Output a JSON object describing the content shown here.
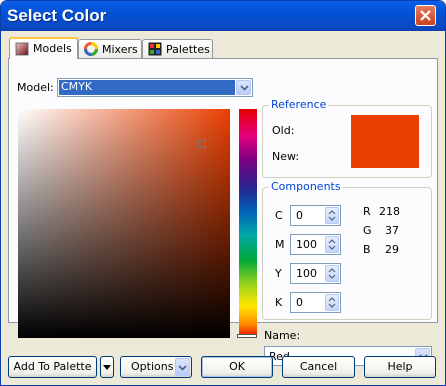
{
  "window": {
    "title": "Select Color"
  },
  "tabs": [
    {
      "label": "Models",
      "active": true,
      "icon": "models-icon"
    },
    {
      "label": "Mixers",
      "active": false,
      "icon": "color-wheel-icon"
    },
    {
      "label": "Palettes",
      "active": false,
      "icon": "palette-grid-icon"
    }
  ],
  "model": {
    "label": "Model:",
    "selected": "CMYK"
  },
  "reference": {
    "title": "Reference",
    "old_label": "Old:",
    "new_label": "New:",
    "old_color": "#ea3f00",
    "new_color": "#ea3f00"
  },
  "components": {
    "title": "Components",
    "cmyk": [
      {
        "label": "C",
        "value": "0"
      },
      {
        "label": "M",
        "value": "100"
      },
      {
        "label": "Y",
        "value": "100"
      },
      {
        "label": "K",
        "value": "0"
      }
    ],
    "rgb": [
      {
        "label": "R",
        "value": "218"
      },
      {
        "label": "G",
        "value": "37"
      },
      {
        "label": "B",
        "value": "29"
      }
    ]
  },
  "name": {
    "label": "Name:",
    "selected": "Red"
  },
  "picker": {
    "hue_color": "#ea3f00"
  },
  "buttons": {
    "add_to_palette": "Add To Palette",
    "options": "Options",
    "ok": "OK",
    "cancel": "Cancel",
    "help": "Help"
  },
  "colors": {
    "title_bar": "#0451d6",
    "group_title": "#0046d5",
    "selection": "#316ac5"
  }
}
